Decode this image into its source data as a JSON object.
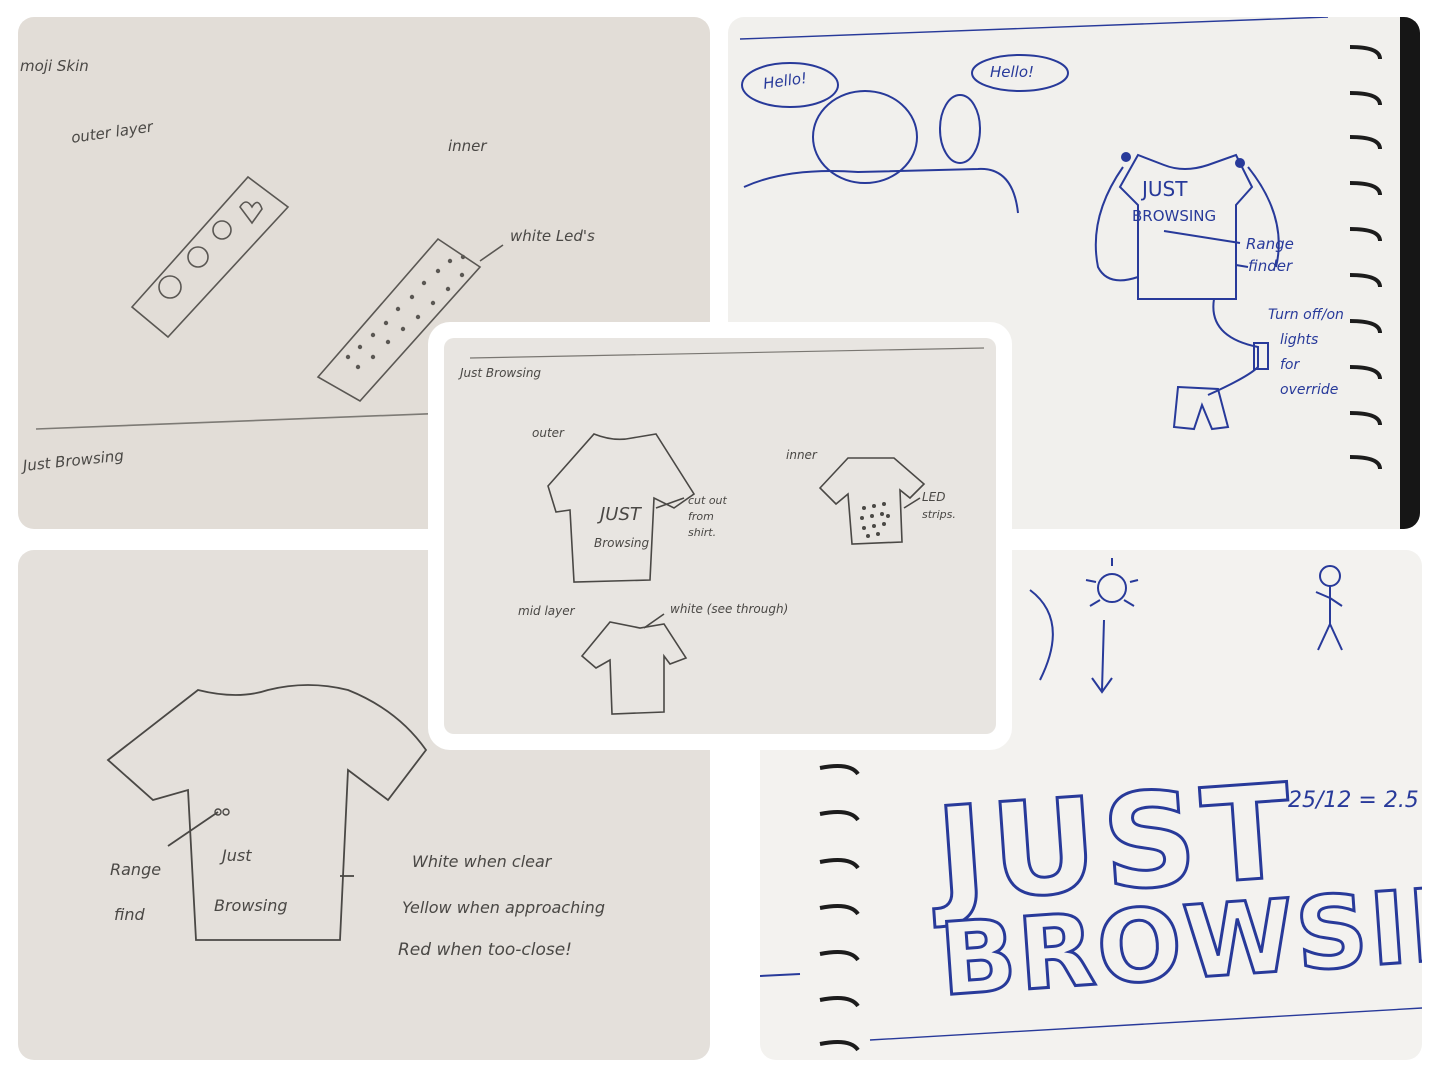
{
  "panel_tl": {
    "heading": "moji Skin",
    "outer": "outer layer",
    "inner": "inner",
    "leds": "white Led's",
    "footer": "Just Browsing"
  },
  "panel_tr": {
    "bubble_left": "Hello!",
    "bubble_right": "Hello!",
    "shirt_line1": "JUST",
    "shirt_line2": "BROWSING",
    "range": "Range",
    "finder": "finder",
    "turn1": "Turn off/on",
    "turn2": "lights",
    "turn3": "for",
    "turn4": "override"
  },
  "panel_center": {
    "heading": "Just Browsing",
    "outer": "outer",
    "inner": "inner",
    "shirt_text1": "JUST",
    "shirt_text2": "Browsing",
    "cutout1": "cut out",
    "cutout2": "from",
    "cutout3": "shirt.",
    "led1": "LED",
    "led2": "strips.",
    "mid": "mid layer",
    "white": "white (see through)"
  },
  "panel_bl": {
    "range1": "Range",
    "range2": "find",
    "shirt1": "Just",
    "shirt2": "Browsing",
    "note1": "White when clear",
    "note2": "Yellow when approaching",
    "note3": "Red when too-close!"
  },
  "panel_br": {
    "big1": "JUST",
    "big2": "BROWSING",
    "calc": "25/12 = 2.5"
  },
  "colors": {
    "paper_grey": "#e3dfda",
    "paper_white": "#f3f2ef",
    "pencil": "#4a4845",
    "ink_blue": "#283a9a",
    "spiral": "#1c1c1c"
  }
}
